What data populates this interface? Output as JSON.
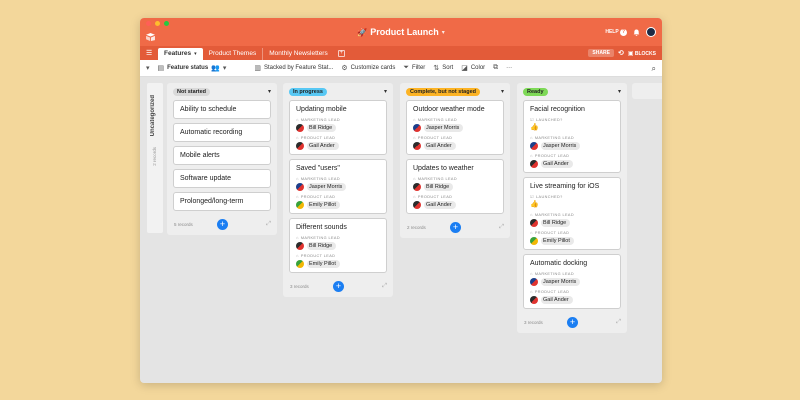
{
  "app": {
    "title": "Product Launch",
    "help_label": "HELP",
    "share_label": "SHARE",
    "blocks_label": "BLOCKS"
  },
  "tabs": [
    {
      "label": "Features"
    },
    {
      "label": "Product Themes"
    },
    {
      "label": "Monthly Newsletters"
    }
  ],
  "toolbar": {
    "view_name": "Feature status",
    "stacked_by": "Stacked by Feature Stat...",
    "customize": "Customize cards",
    "filter": "Filter",
    "sort": "Sort",
    "color": "Color",
    "more": "···"
  },
  "group": {
    "label": "Uncategorized",
    "count": "2 records"
  },
  "field_labels": {
    "marketing": "MARKETING LEAD",
    "product": "PRODUCT LEAD",
    "launched": "LAUNCHED?"
  },
  "columns": [
    {
      "name": "Not started",
      "color": "#d9d9d9",
      "count": "5 records",
      "items": [
        "Ability to schedule",
        "Automatic recording",
        "Mobile alerts",
        "Software update",
        "Prolonged/long-term"
      ]
    },
    {
      "name": "In progress",
      "color": "#58c8f4",
      "count": "3 records",
      "cards": [
        {
          "title": "Updating mobile",
          "marketing": "Bill Ridge",
          "product": "Gail Ander"
        },
        {
          "title": "Saved \"users\"",
          "marketing": "Jasper Morris",
          "product": "Emily Pillot"
        },
        {
          "title": "Different sounds",
          "marketing": "Bill Ridge",
          "product": "Emily Pillot"
        }
      ]
    },
    {
      "name": "Complete, but not staged",
      "color": "#fcb324",
      "count": "2 records",
      "cards": [
        {
          "title": "Outdoor weather mode",
          "marketing": "Jasper Morris",
          "product": "Gail Ander"
        },
        {
          "title": "Updates to weather",
          "marketing": "Bill Ridge",
          "product": "Gail Ander"
        }
      ]
    },
    {
      "name": "Ready",
      "color": "#7ed957",
      "count": "3 records",
      "cards": [
        {
          "title": "Facial recognition",
          "product": "Gail Ander"
        },
        {
          "title": "Live streaming for iOS",
          "marketing": "Bill Ridge",
          "product": "Emily Pillot"
        },
        {
          "title": "Automatic docking",
          "marketing": "Jasper Morris",
          "product": "Gail Ander"
        }
      ]
    }
  ],
  "colors": {
    "brand": "#f06a47",
    "brand_dark": "#e35b39",
    "add_button": "#1b7ef2",
    "background": "#f3d79b"
  }
}
